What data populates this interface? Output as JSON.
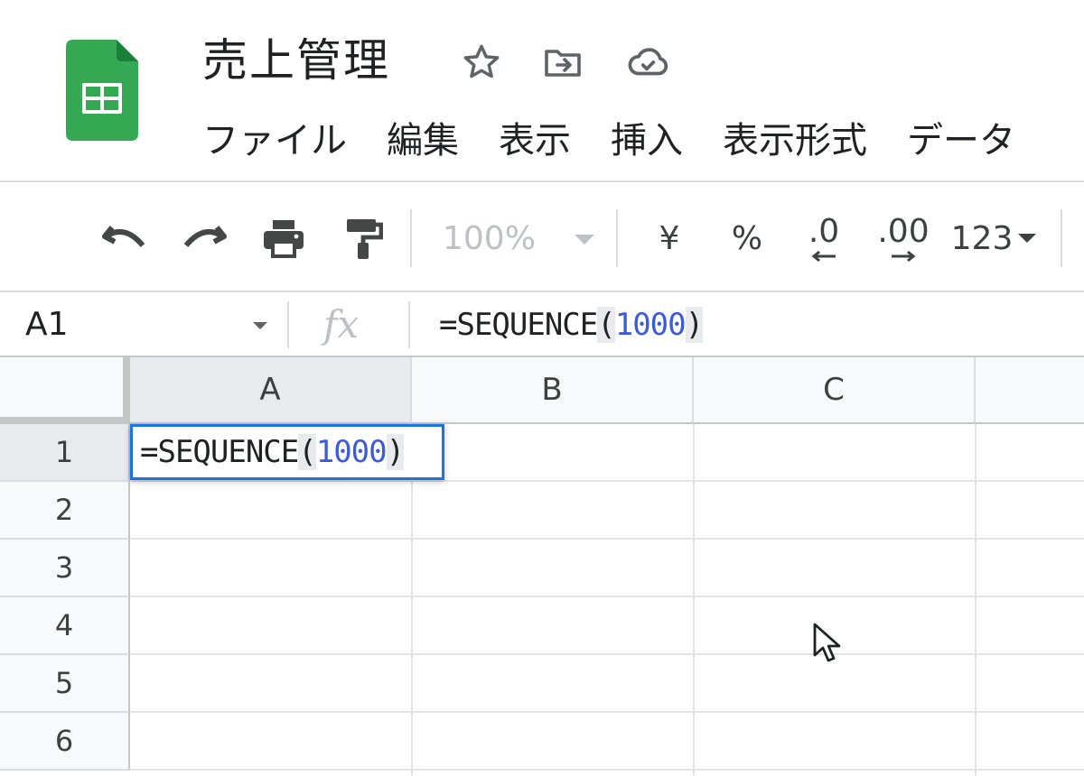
{
  "app": {
    "title": "売上管理",
    "icons": [
      "star-icon",
      "move-to-folder-icon",
      "cloud-saved-icon"
    ],
    "brand_color": "#34a853"
  },
  "menu": {
    "items": [
      "ファイル",
      "編集",
      "表示",
      "挿入",
      "表示形式",
      "データ"
    ]
  },
  "toolbar": {
    "zoom": "100%",
    "currency": "¥",
    "percent": "%",
    "decrease_decimal": ".0",
    "increase_decimal": ".00",
    "more_formats": "123"
  },
  "formula_bar": {
    "name_box": "A1",
    "fx": "fx",
    "formula_prefix": "=SEQUENCE",
    "formula_open": "(",
    "formula_arg": "1000",
    "formula_close": ")"
  },
  "sheet": {
    "columns": [
      "A",
      "B",
      "C"
    ],
    "rows": [
      "1",
      "2",
      "3",
      "4",
      "5",
      "6"
    ],
    "active_cell": "A1",
    "editor": {
      "prefix": "=SEQUENCE",
      "open": "(",
      "arg": "1000",
      "close": ")"
    },
    "selection_color": "#1a73e8"
  }
}
